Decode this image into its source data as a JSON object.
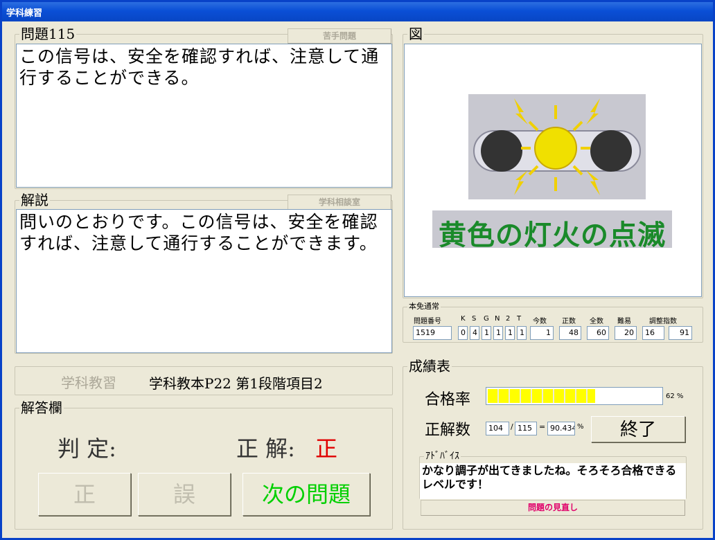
{
  "window": {
    "title": "学科練習"
  },
  "question": {
    "legend": "問題115",
    "weak_button": "苦手問題",
    "text": "この信号は、安全を確認すれば、注意して通行することができる。"
  },
  "explanation": {
    "legend": "解説",
    "consult_button": "学科相談室",
    "text": "問いのとおりです。この信号は、安全を確認すれば、注意して通行することができます。"
  },
  "textbook": {
    "button": "学科教習",
    "reference": "学科教本P22 第1段階項目2"
  },
  "answer": {
    "legend": "解答欄",
    "judgment_label": "判 定:",
    "judgment_value": "",
    "correct_label": "正 解:",
    "correct_value": "正",
    "btn_correct": "正",
    "btn_wrong": "誤",
    "btn_next": "次の問題"
  },
  "figure": {
    "legend": "図",
    "caption": "黄色の灯火の点滅",
    "icon": "traffic-signal-yellow-flashing-icon"
  },
  "stats": {
    "legend": "本免通常",
    "headers": [
      "問題番号",
      "K",
      "S",
      "G",
      "N",
      "2",
      "T",
      "今数",
      "正数",
      "全数",
      "難易",
      "調整指数"
    ],
    "values": [
      "1519",
      "0",
      "4",
      "1",
      "1",
      "1",
      "1",
      "1",
      "48",
      "60",
      "20",
      "16",
      "91"
    ]
  },
  "grades": {
    "legend": "成績表",
    "pass_rate_label": "合格率",
    "pass_rate": 62,
    "pass_rate_text": "62 %",
    "correct_count_label": "正解数",
    "correct": "104",
    "slash": "/",
    "total": "115",
    "equals": "=",
    "ratio": "90.4347",
    "percent": "%",
    "exit_button": "終了",
    "advice_legend": "ｱﾄﾞﾊﾞｲｽ",
    "advice_text": "かなり調子が出てきましたね。そろそろ合格できるレベルです！",
    "review_button": "問題の見直し"
  },
  "colors": {
    "correct_red": "#e00000",
    "next_green": "#00d000",
    "bar_yellow": "#ffff00",
    "review_pink": "#e0006a"
  }
}
